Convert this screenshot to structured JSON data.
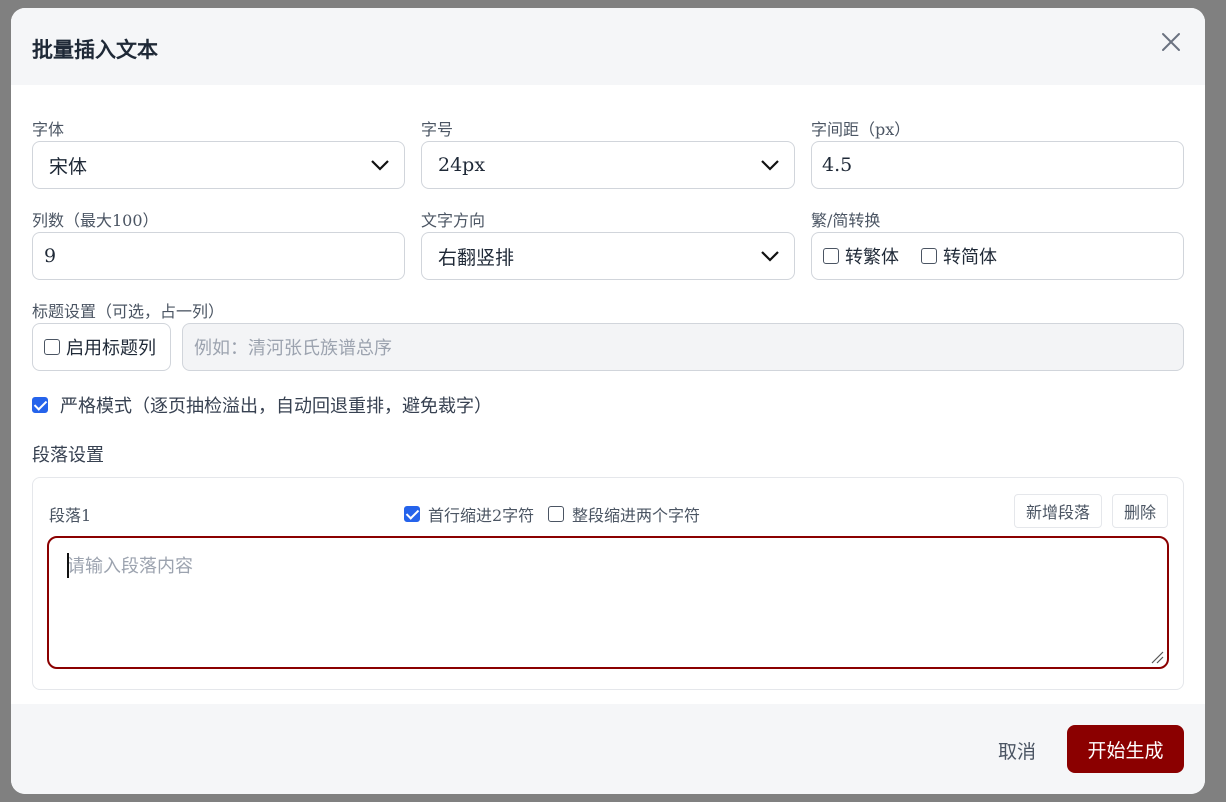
{
  "dialog": {
    "title": "批量插入文本"
  },
  "font": {
    "label": "字体",
    "value": "宋体"
  },
  "size": {
    "label": "字号",
    "value": "24px"
  },
  "spacing": {
    "label": "字间距（px）",
    "value": "4.5"
  },
  "columns": {
    "label": "列数（最大100）",
    "value": "9"
  },
  "direction": {
    "label": "文字方向",
    "value": "右翻竖排"
  },
  "convert": {
    "label": "繁/简转换",
    "traditional": "转繁体",
    "simplified": "转简体"
  },
  "title_settings": {
    "label": "标题设置（可选，占一列）",
    "enable": "启用标题列",
    "placeholder": "例如：清河张氏族谱总序"
  },
  "strict_mode": {
    "label": "严格模式（逐页抽检溢出，自动回退重排，避免裁字）",
    "checked": true
  },
  "paragraphs": {
    "section_title": "段落设置",
    "items": [
      {
        "name": "段落1",
        "first_line_indent": "首行缩进2字符",
        "first_line_indent_checked": true,
        "whole_indent": "整段缩进两个字符",
        "whole_indent_checked": false,
        "placeholder": "请输入段落内容"
      }
    ],
    "add_label": "新增段落",
    "delete_label": "删除"
  },
  "footer": {
    "cancel": "取消",
    "start": "开始生成"
  },
  "colors": {
    "accent": "#8b0000",
    "checkbox": "#2563eb"
  }
}
